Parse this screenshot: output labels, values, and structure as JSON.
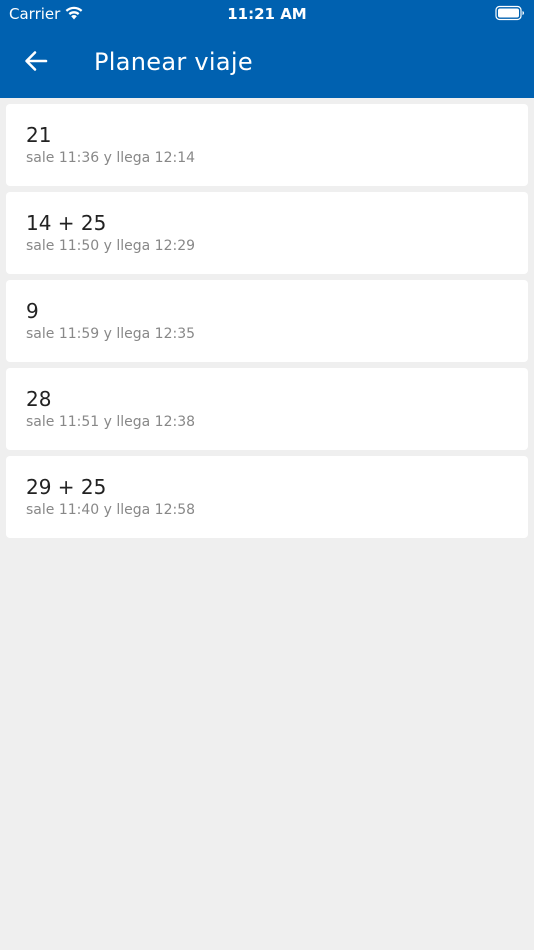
{
  "status_bar": {
    "carrier": "Carrier",
    "time": "11:21 AM",
    "wifi_icon": "wifi-icon",
    "battery_icon": "battery-icon"
  },
  "header": {
    "title": "Planear viaje",
    "back_icon": "arrow-left-icon",
    "background_color": "#0061b0"
  },
  "routes": [
    {
      "route": "21",
      "times": "sale 11:36 y llega 12:14"
    },
    {
      "route": "14 + 25",
      "times": "sale 11:50 y llega 12:29"
    },
    {
      "route": "9",
      "times": "sale 11:59 y llega 12:35"
    },
    {
      "route": "28",
      "times": "sale 11:51 y llega 12:38"
    },
    {
      "route": "29 + 25",
      "times": "sale 11:40 y llega 12:58"
    }
  ]
}
